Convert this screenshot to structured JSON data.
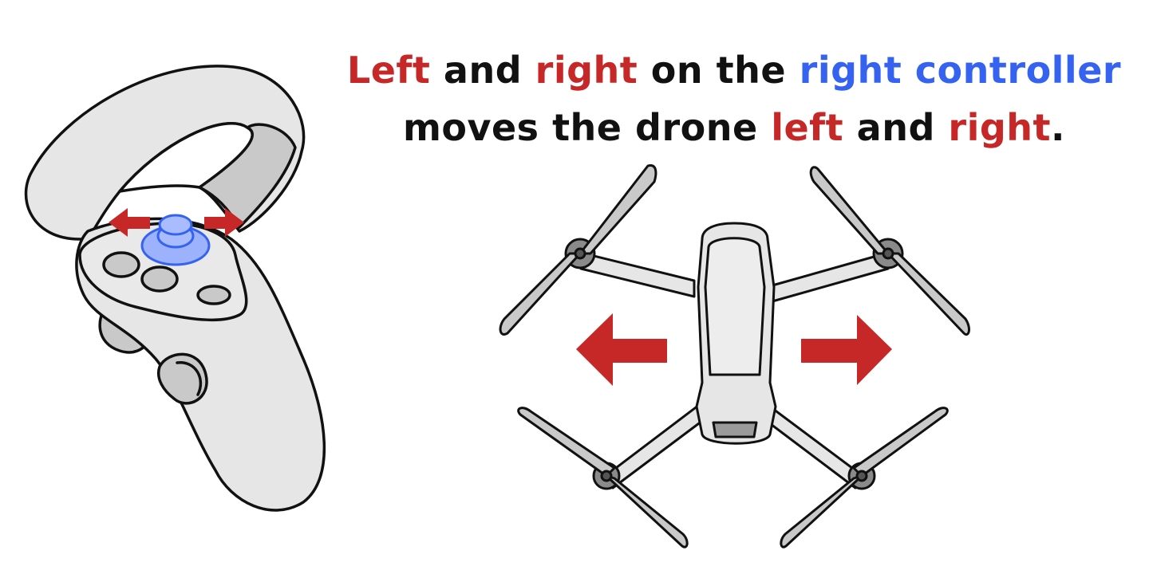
{
  "caption": {
    "line1": [
      {
        "text": "Left",
        "tone": "red"
      },
      {
        "text": " and ",
        "tone": "black"
      },
      {
        "text": "right",
        "tone": "red"
      },
      {
        "text": " on the ",
        "tone": "black"
      },
      {
        "text": "right controller",
        "tone": "blue"
      }
    ],
    "line2": [
      {
        "text": "moves the drone ",
        "tone": "black"
      },
      {
        "text": "left",
        "tone": "red"
      },
      {
        "text": " and ",
        "tone": "black"
      },
      {
        "text": "right",
        "tone": "red"
      },
      {
        "text": ".",
        "tone": "black"
      }
    ]
  },
  "colors": {
    "red": "#c62828",
    "blue": "#3563f0",
    "black": "#111111",
    "device_fill": "#e6e6e6",
    "device_shade": "#c9c9c9",
    "joystick": "#8fa8ff"
  },
  "icons": {
    "controller": "vr-controller-icon",
    "drone": "quadcopter-drone-icon",
    "arrow_left": "arrow-left-icon",
    "arrow_right": "arrow-right-icon"
  }
}
